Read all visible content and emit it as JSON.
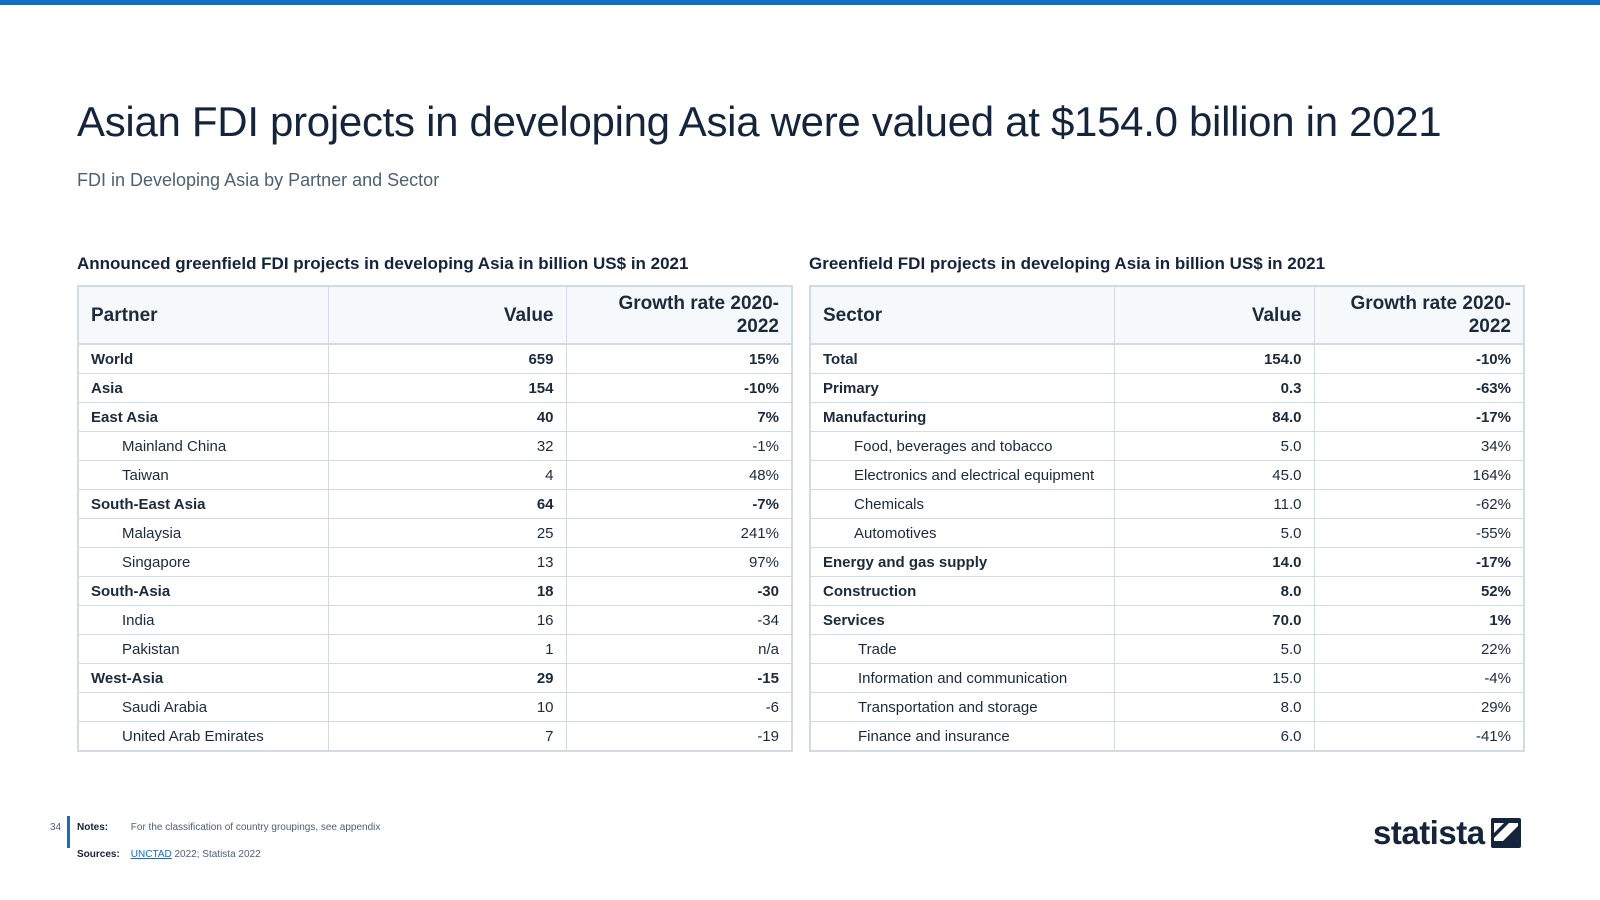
{
  "title": "Asian FDI projects in developing Asia were valued at $154.0 billion in 2021",
  "subtitle": "FDI in Developing Asia by Partner and Sector",
  "left_table": {
    "heading": "Announced greenfield FDI projects in developing Asia in billion US$ in 2021",
    "columns": [
      "Partner",
      "Value",
      "Growth rate 2020-2022"
    ],
    "rows": [
      {
        "label": "World",
        "value": "659",
        "growth": "15%",
        "bold": true,
        "indent": false
      },
      {
        "label": "Asia",
        "value": "154",
        "growth": "-10%",
        "bold": true,
        "indent": false
      },
      {
        "label": "East Asia",
        "value": "40",
        "growth": "7%",
        "bold": true,
        "indent": false
      },
      {
        "label": "Mainland China",
        "value": "32",
        "growth": "-1%",
        "bold": false,
        "indent": true
      },
      {
        "label": "Taiwan",
        "value": "4",
        "growth": "48%",
        "bold": false,
        "indent": true
      },
      {
        "label": "South-East Asia",
        "value": "64",
        "growth": "-7%",
        "bold": true,
        "indent": false
      },
      {
        "label": "Malaysia",
        "value": "25",
        "growth": "241%",
        "bold": false,
        "indent": true
      },
      {
        "label": "Singapore",
        "value": "13",
        "growth": "97%",
        "bold": false,
        "indent": true
      },
      {
        "label": "South-Asia",
        "value": "18",
        "growth": "-30",
        "bold": true,
        "indent": false
      },
      {
        "label": "India",
        "value": "16",
        "growth": "-34",
        "bold": false,
        "indent": true
      },
      {
        "label": "Pakistan",
        "value": "1",
        "growth": "n/a",
        "bold": false,
        "indent": true
      },
      {
        "label": "West-Asia",
        "value": "29",
        "growth": "-15",
        "bold": true,
        "indent": false
      },
      {
        "label": "Saudi Arabia",
        "value": "10",
        "growth": "-6",
        "bold": false,
        "indent": true
      },
      {
        "label": "United Arab Emirates",
        "value": "7",
        "growth": "-19",
        "bold": false,
        "indent": true
      }
    ]
  },
  "right_table": {
    "heading": "Greenfield FDI projects in developing Asia in billion US$ in 2021",
    "columns": [
      "Sector",
      "Value",
      "Growth rate 2020-2022"
    ],
    "rows": [
      {
        "label": "Total",
        "value": "154.0",
        "growth": "-10%",
        "bold": true,
        "indent": false
      },
      {
        "label": "Primary",
        "value": "0.3",
        "growth": "-63%",
        "bold": true,
        "indent": false
      },
      {
        "label": "Manufacturing",
        "value": "84.0",
        "growth": "-17%",
        "bold": true,
        "indent": false
      },
      {
        "label": "Food, beverages and tobacco",
        "value": "5.0",
        "growth": "34%",
        "bold": false,
        "indent": true
      },
      {
        "label": "Electronics and electrical equipment",
        "value": "45.0",
        "growth": "164%",
        "bold": false,
        "indent": true
      },
      {
        "label": "Chemicals",
        "value": "11.0",
        "growth": "-62%",
        "bold": false,
        "indent": true
      },
      {
        "label": "Automotives",
        "value": "5.0",
        "growth": "-55%",
        "bold": false,
        "indent": true
      },
      {
        "label": "Energy and gas supply",
        "value": "14.0",
        "growth": "-17%",
        "bold": true,
        "indent": false
      },
      {
        "label": "Construction",
        "value": "8.0",
        "growth": "52%",
        "bold": true,
        "indent": false
      },
      {
        "label": "Services",
        "value": "70.0",
        "growth": "1%",
        "bold": true,
        "indent": false
      },
      {
        "label": "Trade",
        "value": "5.0",
        "growth": "22%",
        "bold": false,
        "indent": true,
        "indent2": true
      },
      {
        "label": "Information and communication",
        "value": "15.0",
        "growth": "-4%",
        "bold": false,
        "indent": true,
        "indent2": true
      },
      {
        "label": "Transportation and storage",
        "value": "8.0",
        "growth": "29%",
        "bold": false,
        "indent": true,
        "indent2": true
      },
      {
        "label": "Finance and insurance",
        "value": "6.0",
        "growth": "-41%",
        "bold": false,
        "indent": true,
        "indent2": true
      }
    ]
  },
  "footer": {
    "page_number": "34",
    "notes_label": "Notes:",
    "notes_text": "For the classification of country groupings, see appendix",
    "sources_label": "Sources:",
    "sources_link": "UNCTAD",
    "sources_text": " 2022; Statista 2022",
    "logo_text": "statista",
    "logo_icon": "statista-logo-icon"
  },
  "colors": {
    "accent": "#0f6fc6",
    "text": "#14243a",
    "border": "#d3dae2"
  }
}
